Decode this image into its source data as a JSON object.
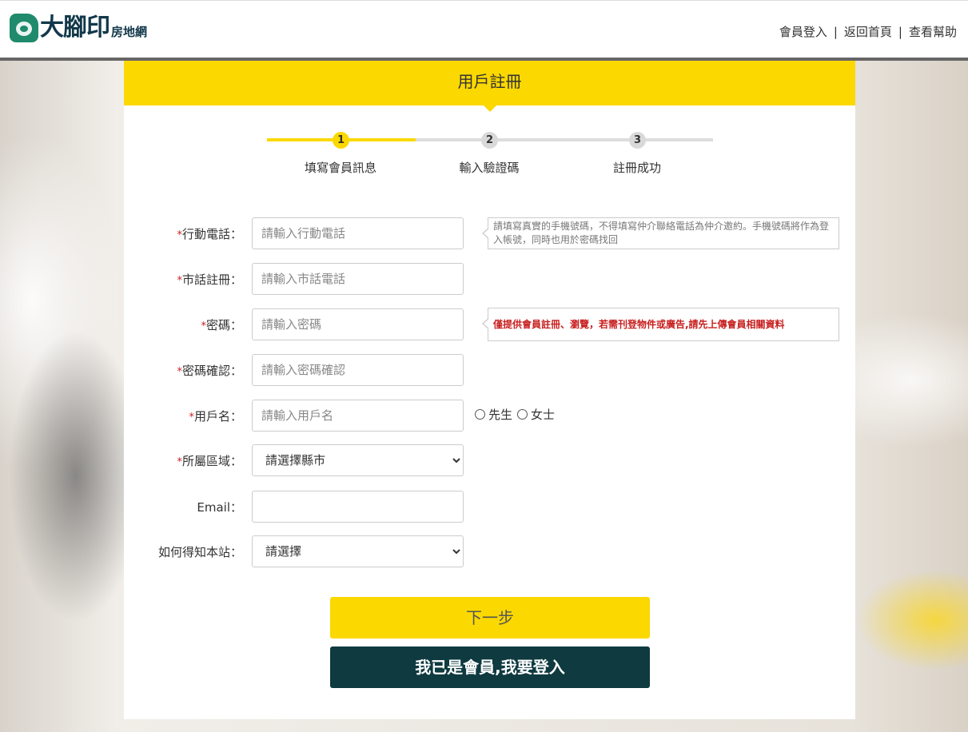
{
  "brand": {
    "name": "大腳印",
    "sub": "房地網"
  },
  "nav": {
    "items": [
      "會員登入",
      "返回首頁",
      "查看幫助"
    ],
    "separator": "|"
  },
  "page": {
    "title": "用戶註冊"
  },
  "steps": [
    {
      "number": "1",
      "label": "填寫會員訊息",
      "active": true
    },
    {
      "number": "2",
      "label": "輸入驗證碼",
      "active": false
    },
    {
      "number": "3",
      "label": "註冊成功",
      "active": false
    }
  ],
  "form": {
    "required_mark": "*",
    "mobile": {
      "label": "行動電話：",
      "placeholder": "請輸入行動電話",
      "value": ""
    },
    "landline": {
      "label": "市話註冊：",
      "placeholder": "請輸入市話電話",
      "value": ""
    },
    "password": {
      "label": "密碼：",
      "placeholder": "請輸入密碼",
      "value": ""
    },
    "password_confirm": {
      "label": "密碼確認：",
      "placeholder": "請輸入密碼確認",
      "value": ""
    },
    "username": {
      "label": "用戶名：",
      "placeholder": "請輸入用戶名",
      "value": ""
    },
    "gender": {
      "options": [
        "先生",
        "女士"
      ],
      "selected": ""
    },
    "region": {
      "label": "所屬區域：",
      "selected": "請選擇縣市"
    },
    "email": {
      "label": "Email：",
      "placeholder": "",
      "value": ""
    },
    "referral": {
      "label": "如何得知本站：",
      "selected": "請選擇"
    }
  },
  "tips": {
    "mobile": "請填寫真實的手機號碼，不得填寫仲介聯絡電話為仲介邀約。手機號碼將作為登入帳號，同時也用於密碼找回",
    "password": "僅提供會員註冊、瀏覽，若需刊登物件或廣告,請先上傳會員相關資料"
  },
  "buttons": {
    "next": "下一步",
    "login": "我已是會員,我要登入"
  },
  "colors": {
    "accent": "#fbd800",
    "dark_button": "#0e3a40",
    "required": "#c81e1e"
  }
}
